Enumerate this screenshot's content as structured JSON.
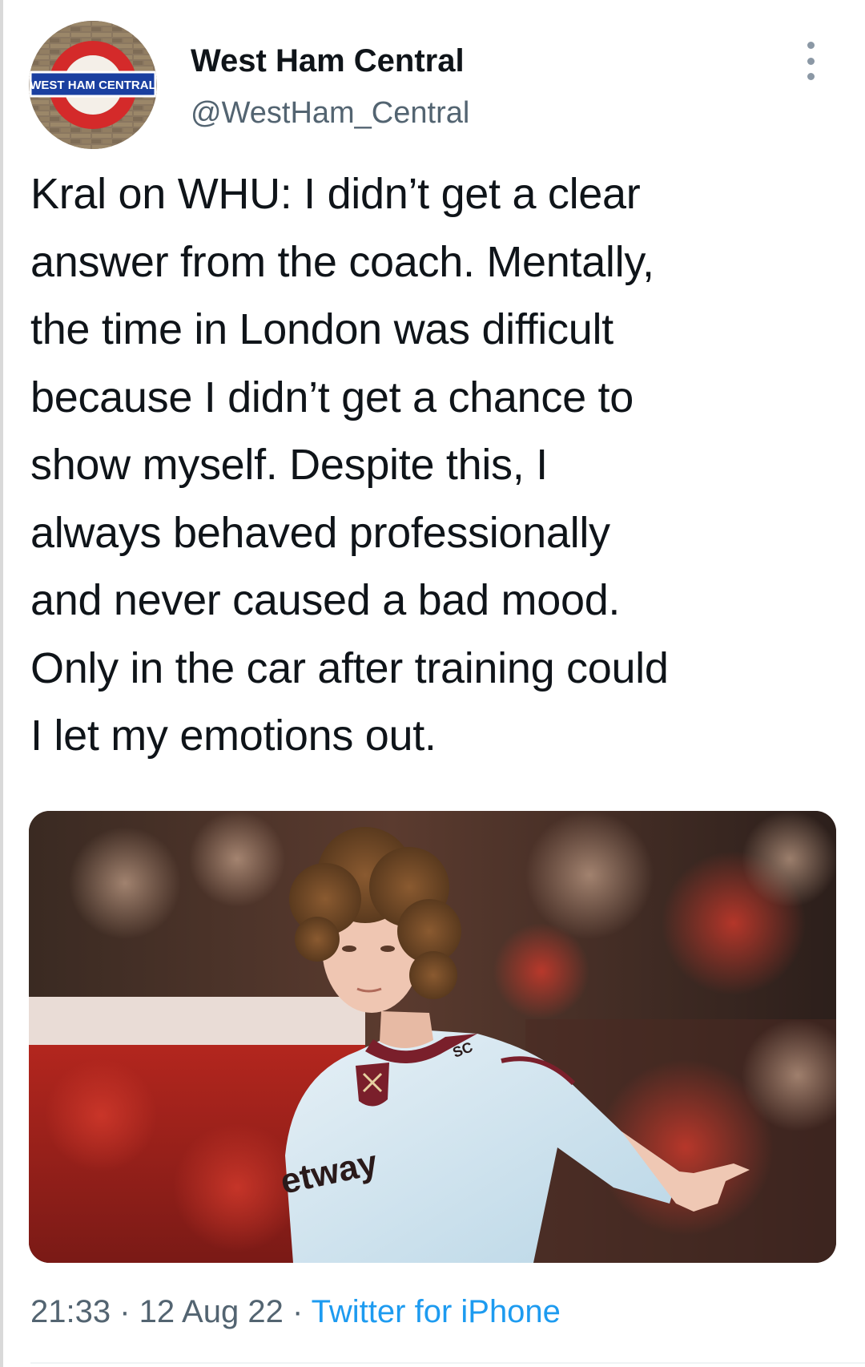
{
  "author": {
    "display_name": "West Ham Central",
    "handle": "@WestHam_Central",
    "avatar_label": "WEST HAM CENTRAL"
  },
  "tweet": {
    "text_lines": [
      "Kral on WHU: I didn’t get a clear",
      "answer from the coach. Mentally,",
      "the time in London was difficult",
      "because I didn’t get a chance to",
      "show myself. Despite this, I",
      "always behaved professionally",
      "and never caused a bad mood.",
      "Only in the car after training could",
      "I let my emotions out."
    ]
  },
  "media": {
    "shirt_sponsor": "etway",
    "sleeve_text": "SC"
  },
  "meta": {
    "time": "21:33",
    "separator": " · ",
    "date": "12 Aug 22",
    "source": "Twitter for iPhone"
  },
  "colors": {
    "text": "#0f1419",
    "secondary": "#536471",
    "link": "#1d9bf0",
    "roundel_red": "#d42a2a",
    "roundel_banner": "#1a3fa0"
  },
  "icons": {
    "more": "more-vertical-icon"
  }
}
